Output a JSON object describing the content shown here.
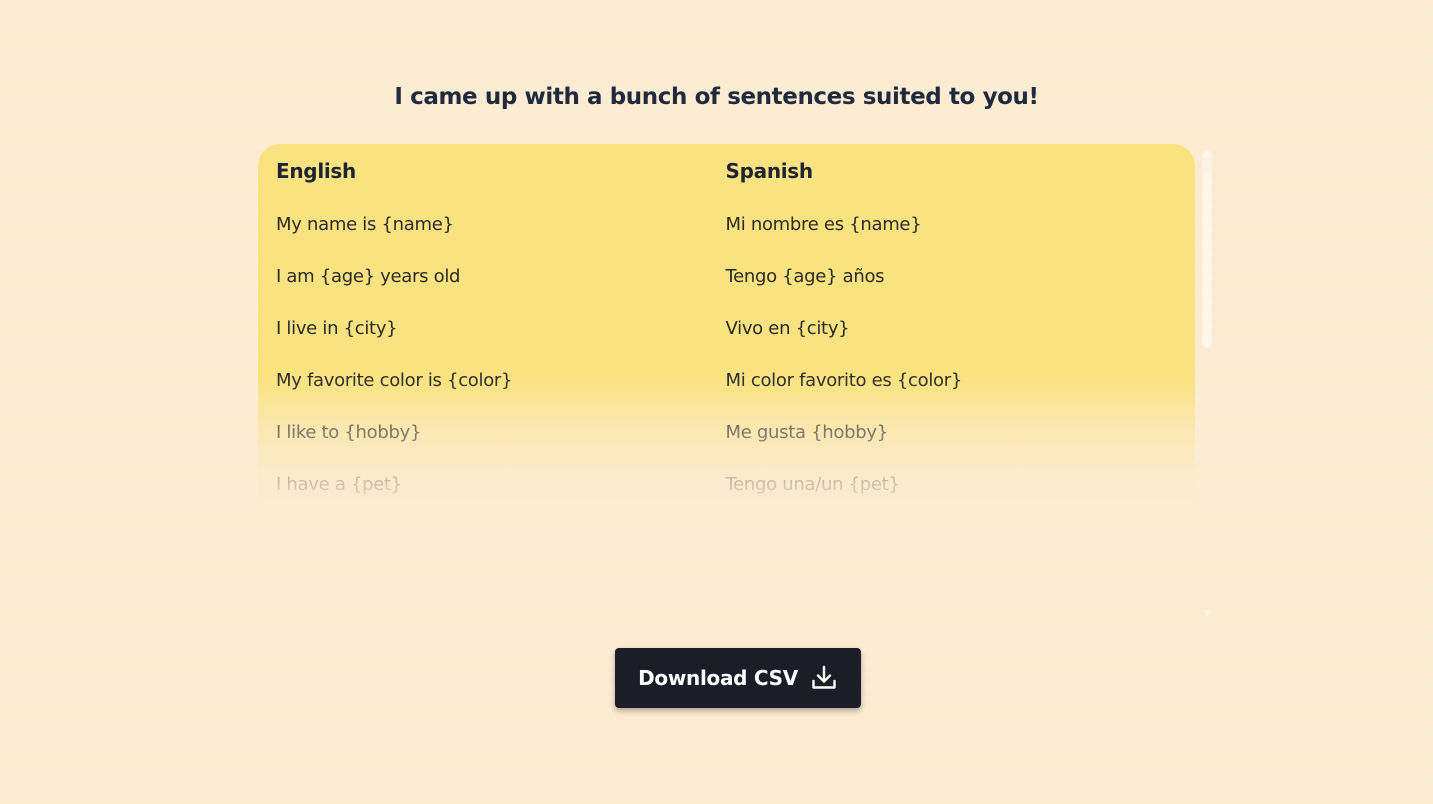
{
  "title": "I came up with a bunch of sentences suited to you!",
  "table": {
    "headers": {
      "english": "English",
      "spanish": "Spanish"
    },
    "rows": [
      {
        "english": "My name is {name}",
        "spanish": "Mi nombre es {name}"
      },
      {
        "english": "I am {age} years old",
        "spanish": "Tengo {age} años"
      },
      {
        "english": "I live in {city}",
        "spanish": "Vivo en {city}"
      },
      {
        "english": "My favorite color is {color}",
        "spanish": "Mi color favorito es {color}"
      },
      {
        "english": "I like to {hobby}",
        "spanish": "Me gusta {hobby}"
      },
      {
        "english": "I have a {pet}",
        "spanish": "Tengo una/un {pet}"
      }
    ]
  },
  "download_button": {
    "label": "Download CSV",
    "icon": "download-icon"
  },
  "colors": {
    "background": "#fdebd3",
    "table_background": "#f9e380",
    "button_background": "#1c1d27",
    "button_text": "#ffffff",
    "heading_text": "#1f2a3f"
  }
}
